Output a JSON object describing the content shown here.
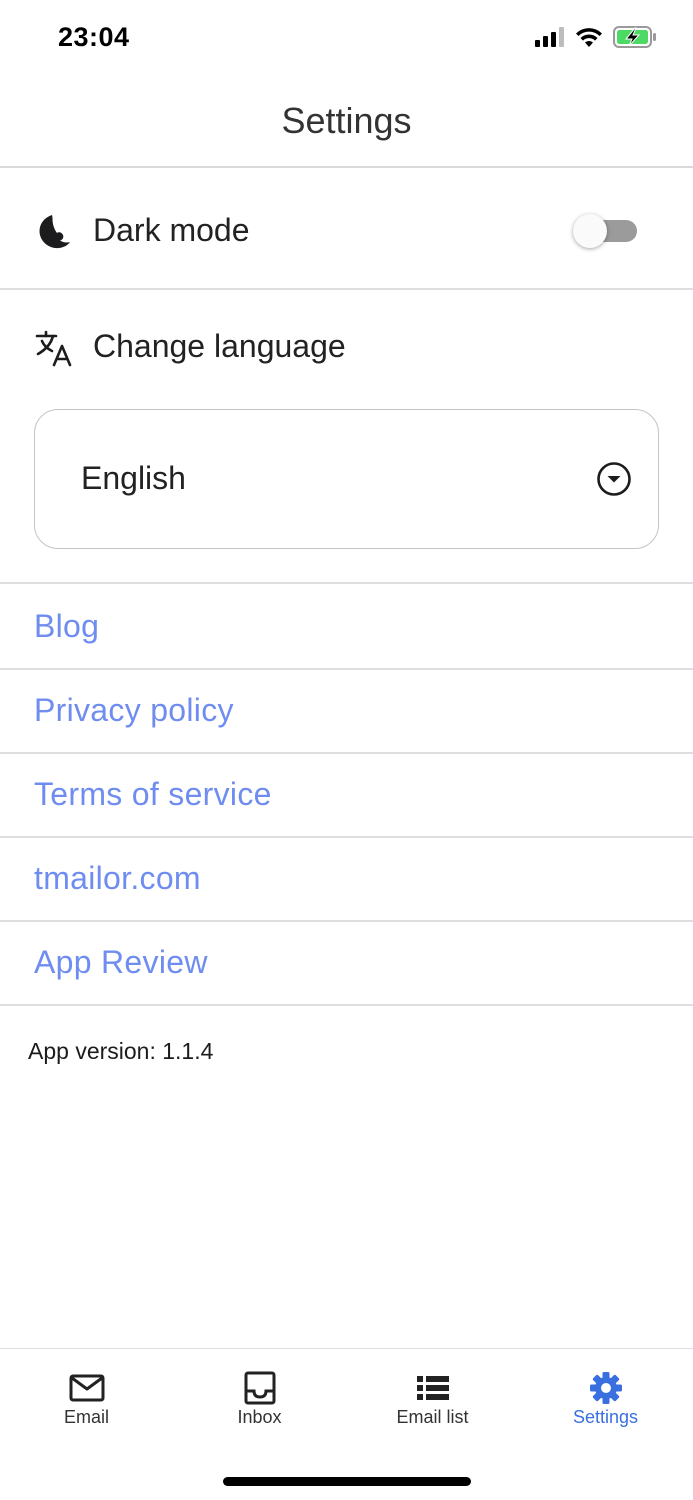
{
  "status_bar": {
    "time": "23:04",
    "icons": [
      "cellular-signal-icon",
      "wifi-icon",
      "battery-charging-icon"
    ]
  },
  "header": {
    "title": "Settings"
  },
  "dark_mode": {
    "label": "Dark mode",
    "enabled": false,
    "icon": "moon-icon"
  },
  "language": {
    "label": "Change language",
    "icon": "translate-icon",
    "selected": "English"
  },
  "links": [
    {
      "label": "Blog"
    },
    {
      "label": "Privacy policy"
    },
    {
      "label": "Terms of service"
    },
    {
      "label": "tmailor.com"
    },
    {
      "label": "App Review"
    }
  ],
  "version": {
    "text": "App version: 1.1.4"
  },
  "tabs": [
    {
      "label": "Email",
      "icon": "mail-icon",
      "active": false
    },
    {
      "label": "Inbox",
      "icon": "inbox-icon",
      "active": false
    },
    {
      "label": "Email list",
      "icon": "list-icon",
      "active": false
    },
    {
      "label": "Settings",
      "icon": "gear-icon",
      "active": true
    }
  ],
  "colors": {
    "link": "#6f8df0",
    "active_tab": "#3a6fe0",
    "battery": "#4cd964"
  }
}
